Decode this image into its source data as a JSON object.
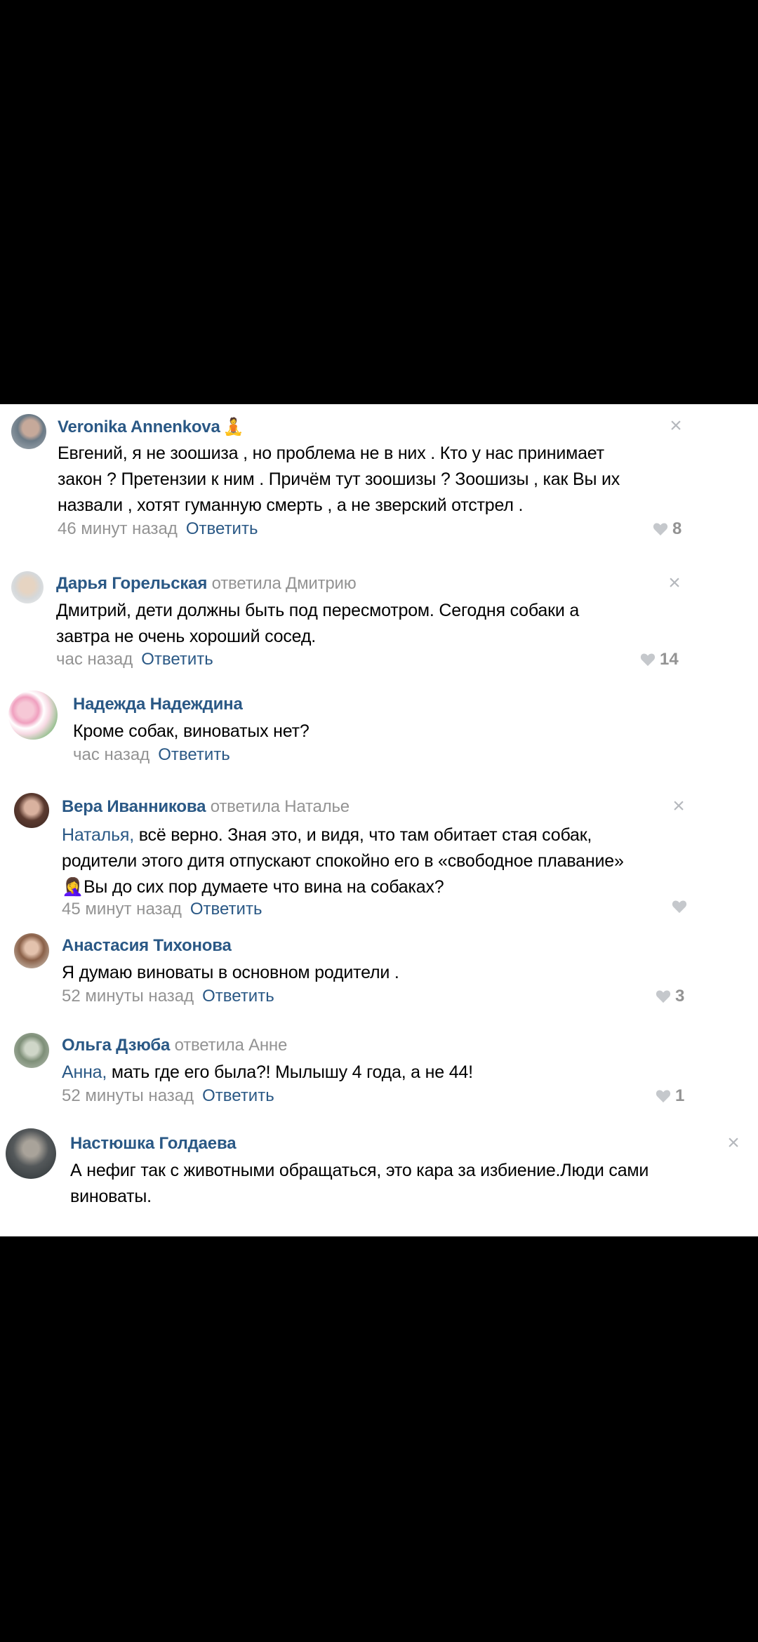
{
  "colors": {
    "link": "#2a5885",
    "meta": "#939393",
    "background": "#ffffff",
    "outer": "#000000"
  },
  "comments": [
    {
      "author": "Veronika Annenkova",
      "emoji": "🧘",
      "reply_to": "",
      "addressee": "",
      "text_lines": [
        "Евгений, я не зоошиза , но проблема не в них . Кто у нас принимает",
        "закон ? Претензии к ним . Причём тут зоошизы ? Зоошизы , как Вы их",
        "назвали , хотят гуманную смерть , а не зверский отстрел ."
      ],
      "time": "46 минут назад",
      "reply_label": "Ответить",
      "likes": "8"
    },
    {
      "author": "Дарья Горельская",
      "reply_to": "ответила Дмитрию",
      "text_lines": [
        "Дмитрий, дети должны быть под пересмотром. Сегодня собаки а",
        "завтра не очень хороший сосед."
      ],
      "time": "час назад",
      "reply_label": "Ответить",
      "likes": "14"
    },
    {
      "author": "Надежда Надеждина",
      "reply_to": "",
      "text_lines": [
        "Кроме собак, виноватых нет?"
      ],
      "time": "час назад",
      "reply_label": "Ответить",
      "likes": ""
    },
    {
      "author": "Вера Иванникова",
      "reply_to": "ответила Наталье",
      "addressee": "Наталья,",
      "text_lines": [
        " всё верно. Зная это, и видя, что там обитает стая собак,",
        "родители этого дитя отпускают спокойно его в «свободное плавание»",
        "Вы до сих пор думаете что вина на собаках?"
      ],
      "emoji": "🤦‍♀️",
      "time": "45 минут назад",
      "reply_label": "Ответить",
      "likes": ""
    },
    {
      "author": "Анастасия Тихонова",
      "reply_to": "",
      "text_lines": [
        "Я думаю виноваты в основном родители ."
      ],
      "time": "52 минуты назад",
      "reply_label": "Ответить",
      "likes": "3"
    },
    {
      "author": "Ольга Дзюба",
      "reply_to": "ответила Анне",
      "addressee": "Анна,",
      "text_lines": [
        " мать где его была?! Мылышу 4 года, а не 44!"
      ],
      "time": "52 минуты назад",
      "reply_label": "Ответить",
      "likes": "1"
    },
    {
      "author": "Настюшка Голдаева",
      "reply_to": "",
      "text_lines": [
        "А нефиг так с животными обращаться, это кара за избиение.Люди сами",
        "виноваты."
      ]
    }
  ]
}
